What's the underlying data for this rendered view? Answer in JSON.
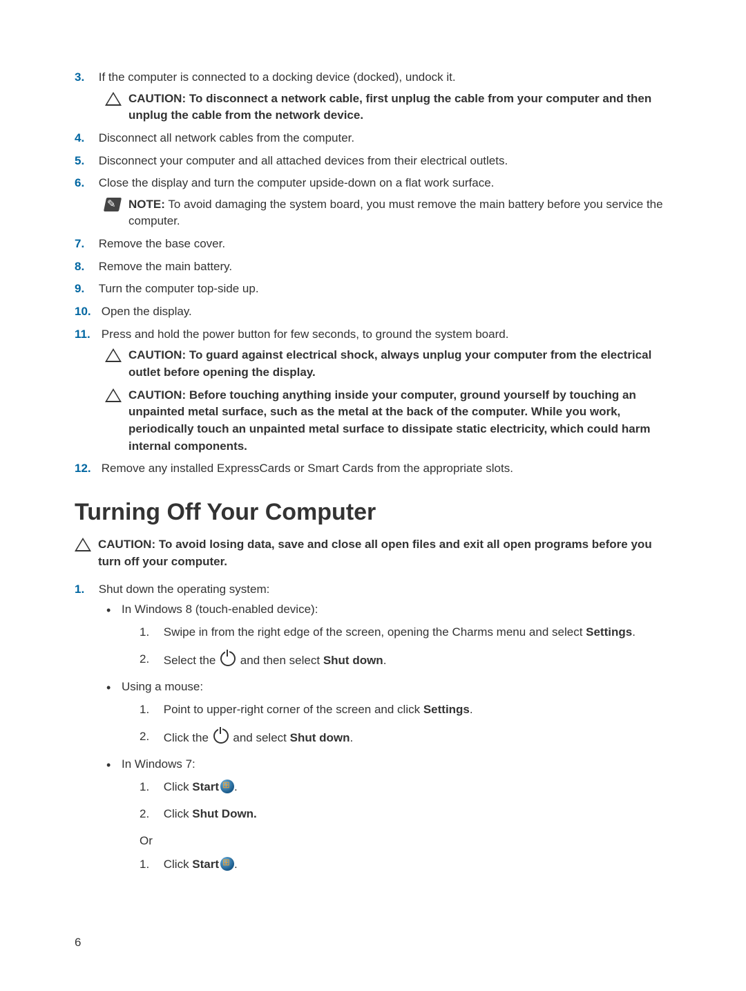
{
  "steps": {
    "s3": {
      "num": "3.",
      "text": "If the computer is connected to a docking device (docked), undock it."
    },
    "caution3": {
      "label": "CAUTION:",
      "text": "To disconnect a network cable, first unplug the cable from your computer and then unplug the cable from the network device."
    },
    "s4": {
      "num": "4.",
      "text": "Disconnect all network cables from the computer."
    },
    "s5": {
      "num": "5.",
      "text": "Disconnect your computer and all attached devices from their electrical outlets."
    },
    "s6": {
      "num": "6.",
      "text": "Close the display and turn the computer upside-down on a flat work surface."
    },
    "note6": {
      "label": "NOTE:",
      "text": "To avoid damaging the system board, you must remove the main battery before you service the computer."
    },
    "s7": {
      "num": "7.",
      "text": "Remove the base cover."
    },
    "s8": {
      "num": "8.",
      "text": "Remove the main battery."
    },
    "s9": {
      "num": "9.",
      "text": "Turn the computer top-side up."
    },
    "s10": {
      "num": "10.",
      "text": "Open the display."
    },
    "s11": {
      "num": "11.",
      "text": "Press and hold the power button for few seconds, to ground the system board."
    },
    "caution11a": {
      "label": "CAUTION:",
      "text": "To guard against electrical shock, always unplug your computer from the electrical outlet before opening the display."
    },
    "caution11b": {
      "label": "CAUTION:",
      "text": "Before touching anything inside your computer, ground yourself by touching an unpainted metal surface, such as the metal at the back of the computer. While you work, periodically touch an unpainted metal surface to dissipate static electricity, which could harm internal components."
    },
    "s12": {
      "num": "12.",
      "text": "Remove any installed ExpressCards or Smart Cards from the appropriate slots."
    }
  },
  "heading": "Turning Off Your Computer",
  "caution_top": {
    "label": "CAUTION:",
    "text": "To avoid losing data, save and close all open files and exit all open programs before you turn off your computer."
  },
  "shutdown": {
    "s1": {
      "num": "1.",
      "text": "Shut down the operating system:"
    },
    "win8": {
      "label": "In Windows 8 (touch-enabled device):",
      "a1_num": "1.",
      "a1_pre": "Swipe in from the right edge of the screen, opening the Charms menu and select ",
      "a1_bold": "Settings",
      "a1_post": ".",
      "a2_num": "2.",
      "a2_pre": "Select the ",
      "a2_mid": " and then select ",
      "a2_bold": "Shut down",
      "a2_post": "."
    },
    "mouse": {
      "label": "Using a mouse:",
      "b1_num": "1.",
      "b1_pre": "Point to upper-right corner of the screen and click ",
      "b1_bold": "Settings",
      "b1_post": ".",
      "b2_num": "2.",
      "b2_pre": "Click the ",
      "b2_mid": " and select ",
      "b2_bold": "Shut down",
      "b2_post": "."
    },
    "win7": {
      "label": "In Windows 7:",
      "c1_num": "1.",
      "c1_pre": "Click ",
      "c1_bold": "Start",
      "c1_post": ".",
      "c2_num": "2.",
      "c2_pre": "Click ",
      "c2_bold": "Shut Down.",
      "or": "Or",
      "d1_num": "1.",
      "d1_pre": "Click ",
      "d1_bold": "Start",
      "d1_post": "."
    }
  },
  "page_number": "6"
}
